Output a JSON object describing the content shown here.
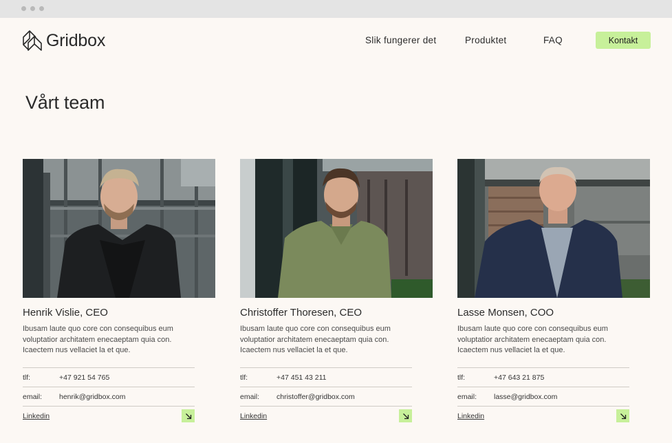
{
  "brand": {
    "name": "Gridbox"
  },
  "nav": {
    "links": [
      "Slik fungerer det",
      "Produktet",
      "FAQ"
    ],
    "cta": "Kontakt"
  },
  "section": {
    "title": "Vårt team"
  },
  "team": [
    {
      "name": "Henrik Vislie, CEO",
      "bio": "Ibusam laute quo core con consequibus eum voluptatior architatem enecaeptam quia con. Icaectem nus vellaciet la et que.",
      "phone_label": "tlf:",
      "phone": "+47 921 54 765",
      "email_label": "email:",
      "email": "henrik@gridbox.com",
      "linkedin": "Linkedin"
    },
    {
      "name": "Christoffer Thoresen, CEO",
      "bio": "Ibusam laute quo core con consequibus eum voluptatior architatem enecaeptam quia con. Icaectem nus vellaciet la et que.",
      "phone_label": "tlf:",
      "phone": "+47 451 43 211",
      "email_label": "email:",
      "email": "christoffer@gridbox.com",
      "linkedin": "Linkedin"
    },
    {
      "name": "Lasse Monsen, COO",
      "bio": "Ibusam laute quo core con consequibus eum voluptatior architatem enecaeptam quia con. Icaectem nus vellaciet la et que.",
      "phone_label": "tlf:",
      "phone": "+47 643 21 875",
      "email_label": "email:",
      "email": "lasse@gridbox.com",
      "linkedin": "Linkedin"
    }
  ],
  "colors": {
    "background": "#fcf8f4",
    "accent": "#c7f09a",
    "text": "#2b2b2b"
  },
  "icons": {
    "logo": "gridbox-logo-icon",
    "arrow": "arrow-down-right-icon"
  }
}
